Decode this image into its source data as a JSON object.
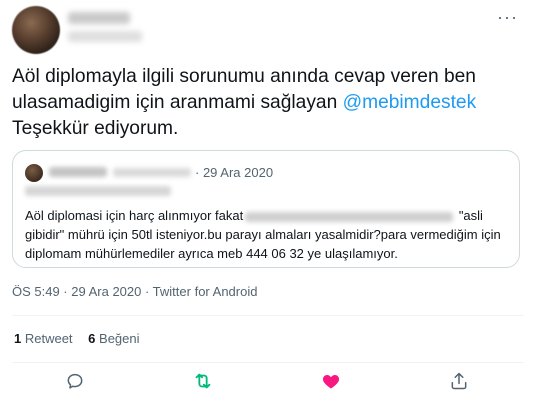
{
  "tweet": {
    "text_line1": "Aöl diplomayla ilgili sorunumu anında cevap veren ben",
    "text_line2": "ulasamadigim için aranmami sağlayan ",
    "mention": "@mebimdestek",
    "text_line3": "Teşekkür ediyorum."
  },
  "quote": {
    "date": "· 29 Ara 2020",
    "text_part1": "Aöl diplomasi için harç alınmıyor fakat",
    "text_part2": " \"asli gibidir\" mührü için 50tl isteniyor.bu parayı almaları yasalmidir?para vermediğim için diplomam mühürlemediler ayrıca meb 444 06 32 ye ulaşılamıyor."
  },
  "meta": {
    "timestamp": "ÖS 5:49 · 29 Ara 2020 · Twitter for Android"
  },
  "stats": {
    "retweets_count": "1",
    "retweets_label": " Retweet",
    "likes_count": "6",
    "likes_label": " Beğeni"
  },
  "actions": [
    {
      "icon": "reply-icon",
      "color": "#536471"
    },
    {
      "icon": "retweet-icon",
      "color": "#00ba7c"
    },
    {
      "icon": "like-icon",
      "color": "#f91880"
    },
    {
      "icon": "share-icon",
      "color": "#536471"
    }
  ]
}
